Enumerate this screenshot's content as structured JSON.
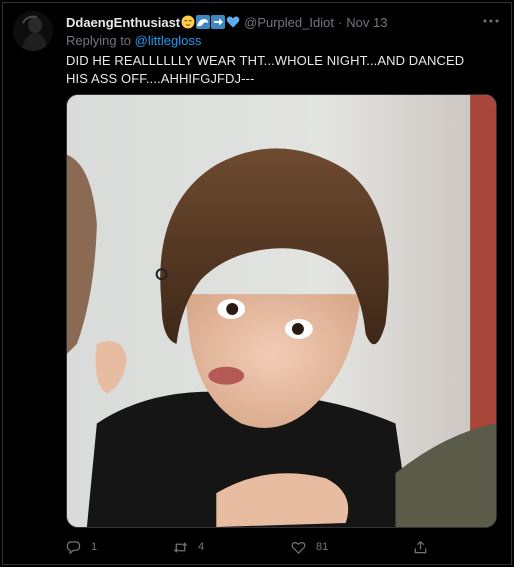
{
  "tweet": {
    "display_name": "DdaengEnthusiast",
    "handle": "@Purpled_Idiot",
    "separator": "·",
    "date": "Nov 13",
    "reply_prefix": "Replying to",
    "reply_to": "@littlegloss",
    "text": "DID HE REALLLLLLY WEAR THT...WHOLE NIGHT...AND DANCED HIS ASS OFF....AHHIFGJFDJ---",
    "name_emojis": [
      "relieved-face-emoji",
      "water-wave-emoji",
      "right-arrow-emoji",
      "blue-heart-emoji"
    ],
    "media_description": "photo"
  },
  "actions": {
    "reply_count": "1",
    "retweet_count": "4",
    "like_count": "81"
  },
  "colors": {
    "background": "#000000",
    "text": "#e7e9ea",
    "muted": "#71767b",
    "link": "#1d9bf0",
    "border": "#2f3336"
  }
}
